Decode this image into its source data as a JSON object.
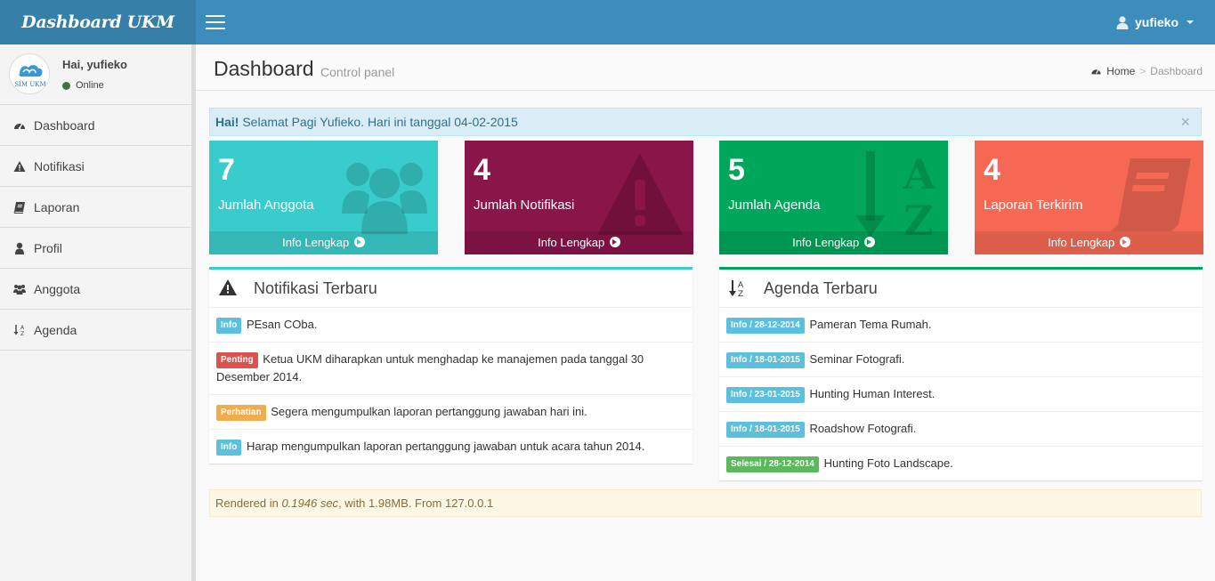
{
  "header": {
    "app_title": "Dashboard UKM",
    "user_name": "yufieko"
  },
  "sidebar": {
    "greeting": "Hai, yufieko",
    "status": "Online",
    "avatar_text": "SIM UKM",
    "items": [
      {
        "label": "Dashboard",
        "icon": "dashboard-icon"
      },
      {
        "label": "Notifikasi",
        "icon": "warning-icon"
      },
      {
        "label": "Laporan",
        "icon": "book-icon"
      },
      {
        "label": "Profil",
        "icon": "user-icon"
      },
      {
        "label": "Anggota",
        "icon": "group-icon"
      },
      {
        "label": "Agenda",
        "icon": "sort-alpha-icon"
      }
    ]
  },
  "content_header": {
    "title": "Dashboard",
    "subtitle": "Control panel",
    "breadcrumb_home": "Home",
    "breadcrumb_current": "Dashboard",
    "breadcrumb_sep": ">"
  },
  "alert": {
    "bold": "Hai!",
    "text": " Selamat Pagi Yufieko. Hari ini tanggal 04-02-2015",
    "close": "×"
  },
  "stat_boxes": [
    {
      "value": "7",
      "label": "Jumlah Anggota",
      "link": "Info Lengkap",
      "color": "#39cccc"
    },
    {
      "value": "4",
      "label": "Jumlah Notifikasi",
      "link": "Info Lengkap",
      "color": "#8a1549"
    },
    {
      "value": "5",
      "label": "Jumlah Agenda",
      "link": "Info Lengkap",
      "color": "#00a65a"
    },
    {
      "value": "4",
      "label": "Laporan Terkirim",
      "link": "Info Lengkap",
      "color": "#f56954"
    }
  ],
  "notifications": {
    "title": "Notifikasi Terbaru",
    "items": [
      {
        "badge": "Info",
        "type": "info",
        "text": "PEsan COba."
      },
      {
        "badge": "Penting",
        "type": "danger",
        "text": "Ketua UKM diharapkan untuk menghadap ke manajemen pada tanggal 30 Desember 2014."
      },
      {
        "badge": "Perhatian",
        "type": "warning",
        "text": "Segera mengumpulkan laporan pertanggung jawaban hari ini."
      },
      {
        "badge": "Info",
        "type": "info",
        "text": "Harap mengumpulkan laporan pertanggung jawaban untuk acara tahun 2014."
      }
    ]
  },
  "agenda": {
    "title": "Agenda Terbaru",
    "items": [
      {
        "badge": "Info / 28-12-2014",
        "type": "info",
        "text": "Pameran Tema Rumah."
      },
      {
        "badge": "Info / 18-01-2015",
        "type": "info",
        "text": "Seminar Fotografi."
      },
      {
        "badge": "Info / 23-01-2015",
        "type": "info",
        "text": "Hunting Human Interest."
      },
      {
        "badge": "Info / 18-01-2015",
        "type": "info",
        "text": "Roadshow Fotografi."
      },
      {
        "badge": "Selesai / 28-12-2014",
        "type": "success",
        "text": "Hunting Foto Landscape."
      }
    ]
  },
  "footer": {
    "prefix": "Rendered in ",
    "time": "0.1946 sec",
    "suffix": ", with 1.98MB. From 127.0.0.1"
  }
}
